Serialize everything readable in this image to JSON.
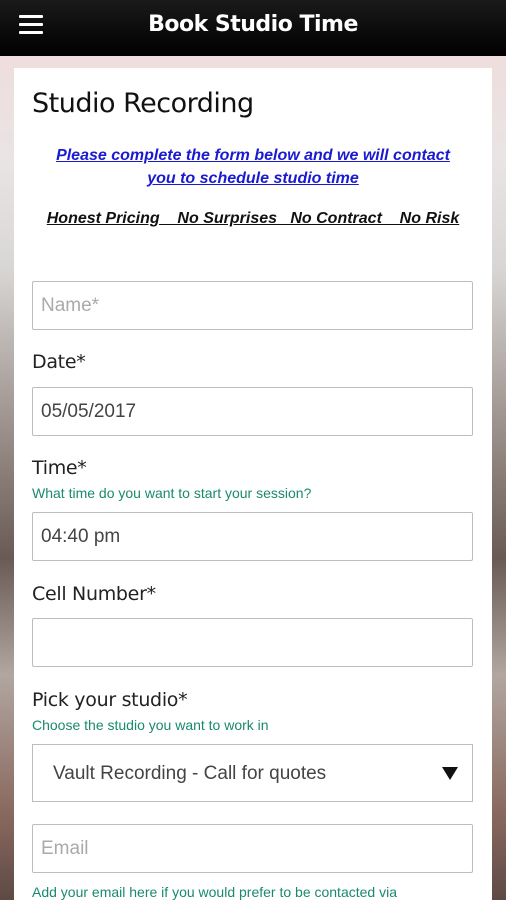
{
  "header": {
    "title": "Book Studio Time",
    "menu_icon": "hamburger-menu-icon"
  },
  "form": {
    "heading": "Studio Recording",
    "intro": "Please complete the form below and we will contact you to schedule studio time",
    "perks": "Honest Pricing    No Surprises   No Contract    No Risk",
    "name": {
      "placeholder": "Name*",
      "value": ""
    },
    "date": {
      "label": "Date*",
      "value": "05/05/2017"
    },
    "time": {
      "label": "Time*",
      "hint": "What time do you want to start your session?",
      "value": "04:40 pm"
    },
    "cell": {
      "label": "Cell Number*",
      "value": ""
    },
    "studio": {
      "label": "Pick your studio*",
      "hint": "Choose the studio you want to work in",
      "value": "Vault Recording - Call for quotes",
      "caret_icon": "dropdown-caret-icon"
    },
    "email": {
      "placeholder": "Email",
      "value": "",
      "hint": "Add your email here if you would prefer to be contacted via"
    }
  },
  "colors": {
    "intro_link": "#1a1ad0",
    "hint_text": "#1a8a6c",
    "topbar": "#000000"
  }
}
